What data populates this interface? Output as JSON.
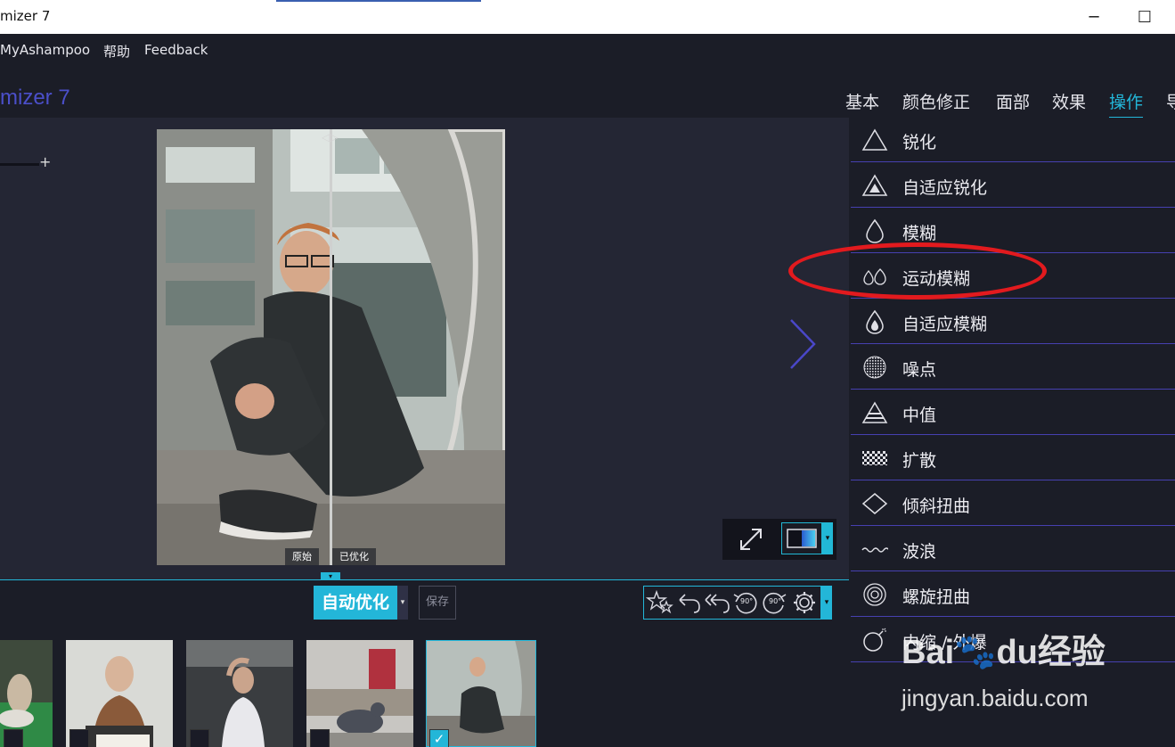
{
  "window": {
    "title": "mizer 7",
    "minimize_glyph": "─",
    "maximize_glyph": "☐"
  },
  "menu": {
    "items": [
      "MyAshampoo",
      "帮助",
      "Feedback"
    ]
  },
  "app": {
    "logo_text": "mizer 7"
  },
  "tabs": [
    {
      "label": "基本",
      "active": false
    },
    {
      "label": "颜色修正",
      "active": false
    },
    {
      "label": "面部",
      "active": false
    },
    {
      "label": "效果",
      "active": false
    },
    {
      "label": "操作",
      "active": true
    },
    {
      "label": "导",
      "active": false
    }
  ],
  "preview": {
    "label_original": "原始",
    "label_optimized": "已优化",
    "slider_plus": "+"
  },
  "toolbar": {
    "auto_optimize": "自动优化",
    "save": "保存",
    "dropdown_glyph": "▾",
    "notch_glyph": "▾",
    "rotate_label": "90°"
  },
  "operations": [
    {
      "label": "锐化",
      "icon": "triangle-outline-icon"
    },
    {
      "label": "自适应锐化",
      "icon": "triangle-filled-icon"
    },
    {
      "label": "模糊",
      "icon": "drop-outline-icon"
    },
    {
      "label": "运动模糊",
      "icon": "motion-drops-icon"
    },
    {
      "label": "自适应模糊",
      "icon": "drop-filled-icon"
    },
    {
      "label": "噪点",
      "icon": "noise-circle-icon"
    },
    {
      "label": "中值",
      "icon": "median-triangle-icon"
    },
    {
      "label": "扩散",
      "icon": "diffuse-dots-icon"
    },
    {
      "label": "倾斜扭曲",
      "icon": "diamond-icon"
    },
    {
      "label": "波浪",
      "icon": "wave-icon"
    },
    {
      "label": "螺旋扭曲",
      "icon": "spiral-icon"
    },
    {
      "label": "内缩 / 外爆",
      "icon": "bomb-icon"
    }
  ],
  "filmstrip": {
    "selected_index": 4,
    "check_glyph": "✓"
  },
  "watermark": {
    "logo": "Bai🐾du经验",
    "url": "jingyan.baidu.com"
  },
  "colors": {
    "accent": "#23b6d8",
    "logo": "#4b4fc9",
    "annotation": "#e21a1e",
    "divider": "#4640b0"
  }
}
